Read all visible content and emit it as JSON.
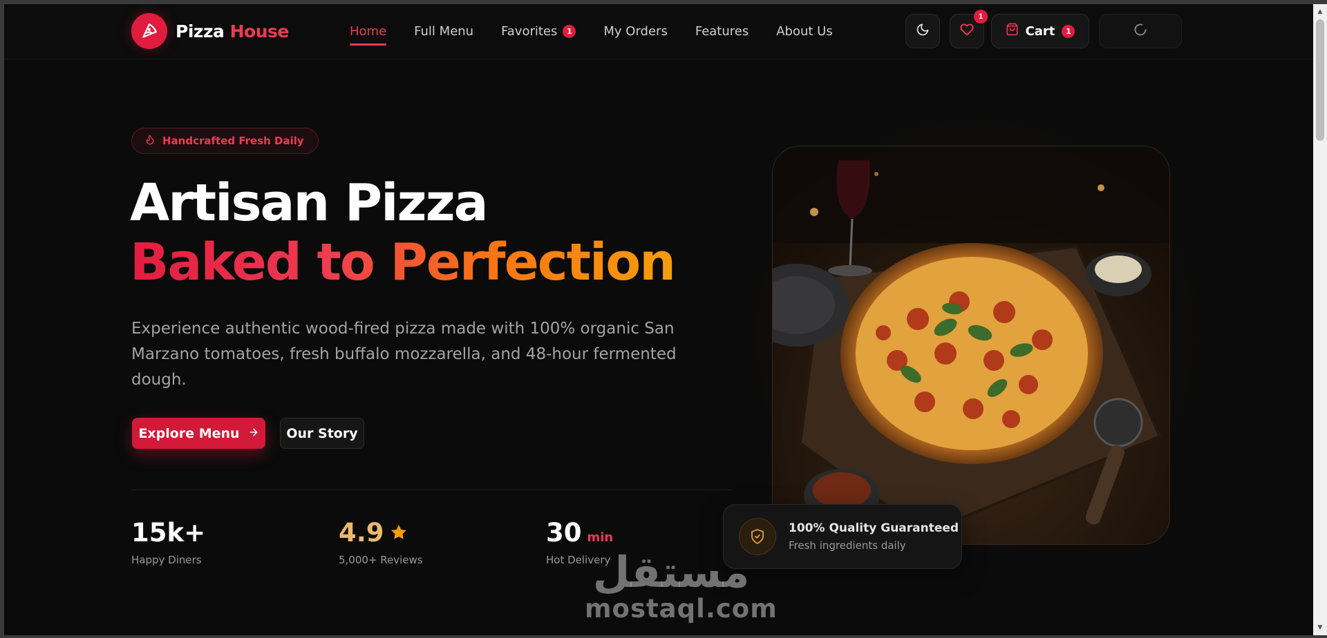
{
  "nav": {
    "logo_primary": "Pizza",
    "logo_accent": "House",
    "items": [
      {
        "label": "Home",
        "active": true
      },
      {
        "label": "Full Menu"
      },
      {
        "label": "Favorites",
        "badge": "1"
      },
      {
        "label": "My Orders"
      },
      {
        "label": "Features"
      },
      {
        "label": "About Us"
      }
    ],
    "favorites_count": "1",
    "cart_label": "Cart",
    "cart_count": "1",
    "icons": [
      "moon-icon",
      "heart-icon",
      "shopping-bag-icon",
      "loader-icon"
    ]
  },
  "hero": {
    "tagline": "Handcrafted Fresh Daily",
    "title_line1": "Artisan Pizza",
    "title_line2": "Baked to Perfection",
    "description": "Experience authentic wood-fired pizza made with 100% organic San Marzano tomatoes, fresh buffalo mozzarella, and 48-hour fermented dough.",
    "primary_button": "Explore Menu",
    "secondary_button": "Our Story",
    "stats": [
      {
        "value": "15k+",
        "label": "Happy Diners"
      },
      {
        "value": "4.9",
        "label": "5,000+ Reviews"
      },
      {
        "value": "30",
        "unit": "min",
        "label": "Hot Delivery"
      }
    ],
    "quality_title": "100% Quality Guaranteed",
    "quality_subtitle": "Fresh ingredients daily"
  },
  "watermark": {
    "arabic": "مستقل",
    "latin": "mostaql.com"
  },
  "colors": {
    "background": "#0b0b0b",
    "accent_red": "#e11d3f",
    "accent_orange": "#f59e0b",
    "star": "#f59e0b"
  }
}
